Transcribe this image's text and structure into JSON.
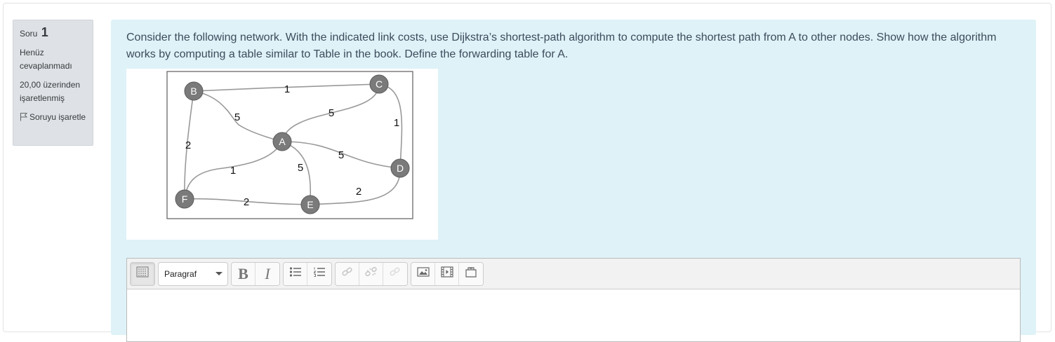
{
  "sidebar": {
    "question_label": "Soru",
    "question_number": "1",
    "status": "Henüz cevaplanmadı",
    "marks": "20,00 üzerinden işaretlenmiş",
    "flag_label": "Soruyu işaretle"
  },
  "question": {
    "text": "Consider the following network. With the indicated link costs, use Dijkstra’s shortest-path algorithm to compute the shortest path from  A to other nodes. Show how the algorithm works by computing a table similar to Table in the book. Define the forwarding table for A."
  },
  "figure": {
    "nodes": {
      "A": "A",
      "B": "B",
      "C": "C",
      "D": "D",
      "E": "E",
      "F": "F"
    },
    "link_costs": {
      "B-C": "1",
      "B-A": "5",
      "B-F": "2",
      "A-C": "5",
      "C-D": "1",
      "A-D": "5",
      "A-F": "1",
      "A-E": "5",
      "F-E": "2",
      "E-D": "2"
    }
  },
  "editor": {
    "format_value": "Paragraf",
    "toolbar_icons": [
      "toolbar-toggle-icon",
      "bold-icon",
      "italic-icon",
      "unordered-list-icon",
      "ordered-list-icon",
      "link-icon",
      "unlink-icon",
      "link-disabled-icon",
      "image-icon",
      "media-icon",
      "manage-files-icon"
    ]
  }
}
